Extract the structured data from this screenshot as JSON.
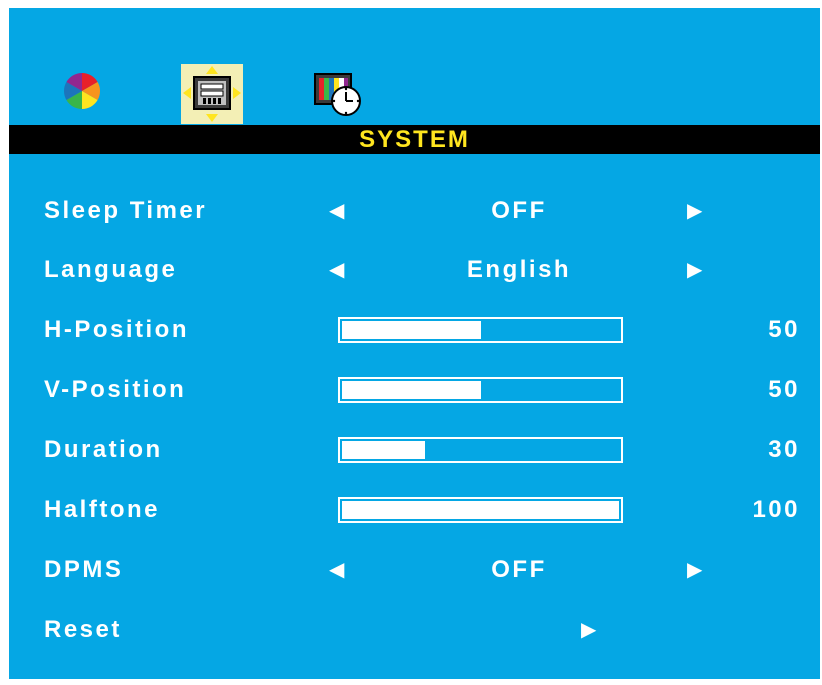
{
  "tabs": [
    {
      "icon": "color-wheel-icon"
    },
    {
      "icon": "system-settings-icon",
      "selected": true
    },
    {
      "icon": "clock-screen-icon"
    }
  ],
  "header": {
    "title": "SYSTEM"
  },
  "colors": {
    "background": "#05a7e4",
    "header_bg": "#000000",
    "header_text": "#ffe51f",
    "text": "#ffffff",
    "selected_tab_bg": "#f3efb5"
  },
  "menu": {
    "sleep_timer": {
      "label": "Sleep Timer",
      "value": "OFF"
    },
    "language": {
      "label": "Language",
      "value": "English"
    },
    "h_position": {
      "label": "H-Position",
      "value": "50",
      "level": 50,
      "max": 100
    },
    "v_position": {
      "label": "V-Position",
      "value": "50",
      "level": 50,
      "max": 100
    },
    "duration": {
      "label": "Duration",
      "value": "30",
      "level": 30,
      "max": 100
    },
    "halftone": {
      "label": "Halftone",
      "value": "100",
      "level": 100,
      "max": 100
    },
    "dpms": {
      "label": "DPMS",
      "value": "OFF"
    },
    "reset": {
      "label": "Reset"
    }
  }
}
